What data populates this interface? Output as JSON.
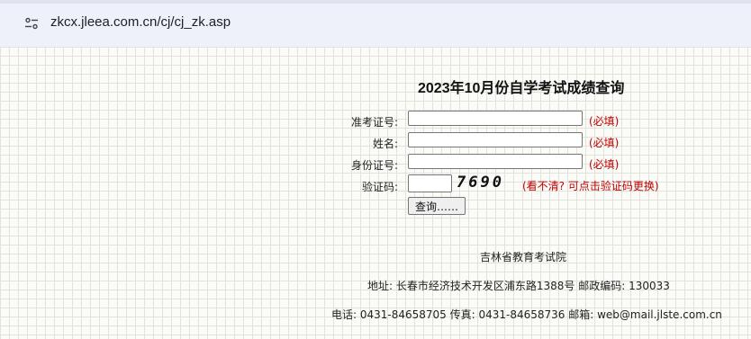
{
  "browser": {
    "url": "zkcx.jleea.com.cn/cj/cj_zk.asp",
    "site_info_icon": "tune-icon"
  },
  "page": {
    "title": "2023年10月份自学考试成绩查询",
    "form": {
      "admission_label": "准考证号:",
      "name_label": "姓名:",
      "id_label": "身份证号:",
      "captcha_label": "验证码:",
      "required_note": "(必填)",
      "captcha_code": "7690",
      "captcha_hint": "(看不清? 可点击验证码更换)",
      "submit_label": "查询……"
    },
    "footer": {
      "org": "吉林省教育考试院",
      "address": "地址: 长春市经济技术开发区浦东路1388号    邮政编码: 130033",
      "contact": "电话: 0431-84658705 传真: 0431-84658736 邮箱: web@mail.jlste.com.cn"
    }
  }
}
